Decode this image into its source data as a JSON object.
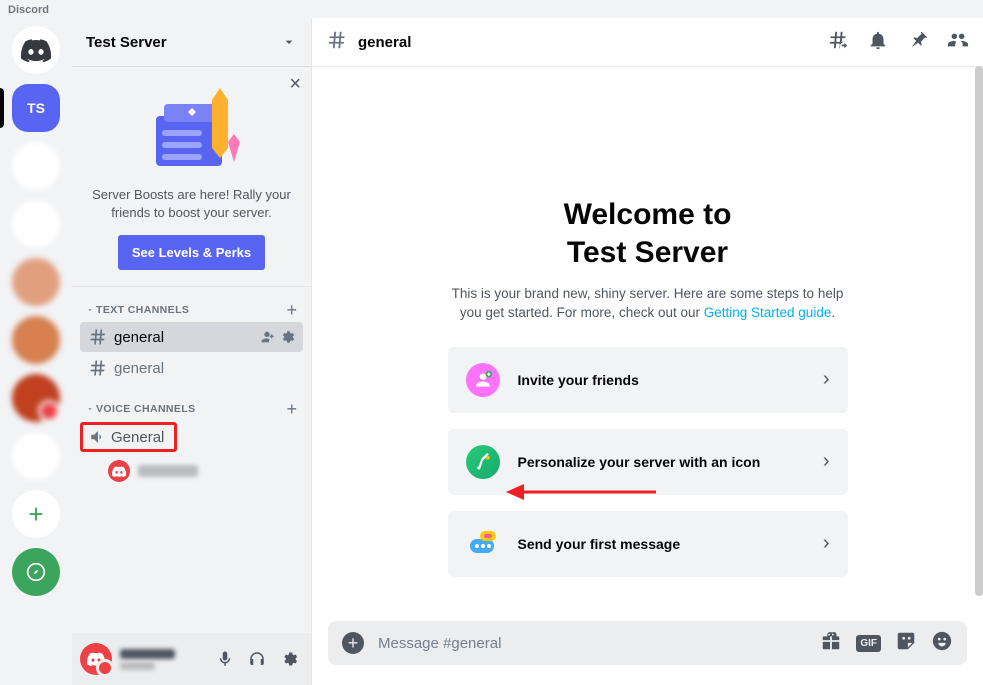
{
  "app_name": "Discord",
  "server": {
    "name": "Test Server",
    "initials": "TS"
  },
  "boost_banner": {
    "text": "Server Boosts are here! Rally your friends to boost your server.",
    "button": "See Levels & Perks"
  },
  "sections": {
    "text_label": "TEXT CHANNELS",
    "voice_label": "VOICE CHANNELS"
  },
  "text_channels": [
    {
      "name": "general",
      "active": true
    },
    {
      "name": "general",
      "active": false
    }
  ],
  "voice_channels": [
    {
      "name": "General"
    }
  ],
  "header": {
    "channel": "general"
  },
  "welcome": {
    "title_line1": "Welcome to",
    "title_line2": "Test Server",
    "subtitle_pre": "This is your brand new, shiny server. Here are some steps to help you get started. For more, check out our ",
    "subtitle_link": "Getting Started guide",
    "subtitle_post": ".",
    "cards": [
      {
        "label": "Invite your friends"
      },
      {
        "label": "Personalize your server with an icon"
      },
      {
        "label": "Send your first message"
      }
    ]
  },
  "composer": {
    "placeholder": "Message #general"
  }
}
